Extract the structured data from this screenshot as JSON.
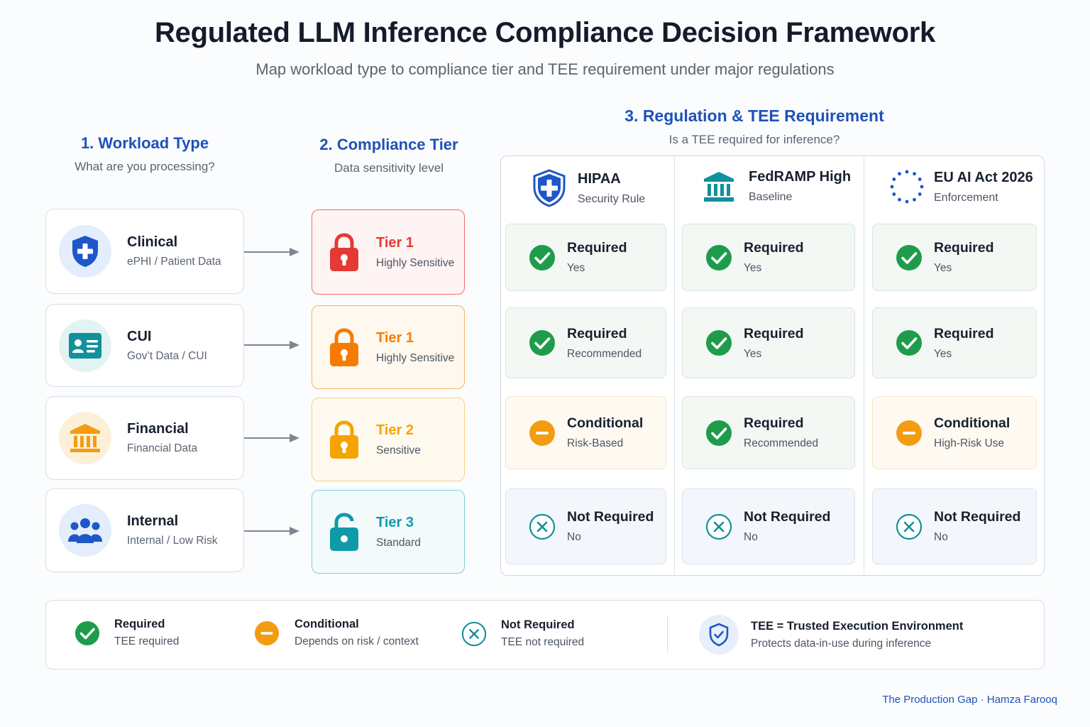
{
  "title": "Regulated LLM Inference Compliance Decision Framework",
  "subtitle": "Map workload type to compliance tier and TEE requirement under major regulations",
  "columns": [
    {
      "heading": "1. Workload Type",
      "sub": "What are you processing?"
    },
    {
      "heading": "2. Compliance Tier",
      "sub": "Data sensitivity level"
    },
    {
      "heading": "3. Regulation & TEE Requirement",
      "sub": "Is a TEE required for inference?"
    }
  ],
  "workloads": [
    {
      "title": "Clinical",
      "sub": "ePHI / Patient Data",
      "icon": "shield-plus-icon"
    },
    {
      "title": "CUI",
      "sub": "Gov’t Data / CUI",
      "icon": "id-card-icon"
    },
    {
      "title": "Financial",
      "sub": "Financial Data",
      "icon": "bank-icon"
    },
    {
      "title": "Internal",
      "sub": "Internal / Low Risk",
      "icon": "people-icon"
    }
  ],
  "tiers": [
    {
      "title": "Tier 1",
      "sub": "Highly Sensitive",
      "color": "#e53935",
      "icon": "lock-closed-icon"
    },
    {
      "title": "Tier 1",
      "sub": "Highly Sensitive",
      "color": "#f57c00",
      "icon": "lock-closed-icon"
    },
    {
      "title": "Tier 2",
      "sub": "Sensitive",
      "color": "#f5a300",
      "icon": "lock-closed-icon"
    },
    {
      "title": "Tier 3",
      "sub": "Standard",
      "color": "#0f9aa8",
      "icon": "lock-open-icon"
    }
  ],
  "regulations": [
    {
      "title": "HIPAA",
      "sub": "Security Rule",
      "icon": "shield-plus-icon"
    },
    {
      "title": "FedRAMP High",
      "sub": "Baseline",
      "icon": "bank-icon"
    },
    {
      "title": "EU AI Act 2026",
      "sub": "Enforcement",
      "icon": "eu-stars-icon"
    }
  ],
  "matrix": [
    [
      {
        "status": "Required",
        "sub": "Yes"
      },
      {
        "status": "Required",
        "sub": "Yes"
      },
      {
        "status": "Required",
        "sub": "Yes"
      }
    ],
    [
      {
        "status": "Required",
        "sub": "Recommended"
      },
      {
        "status": "Required",
        "sub": "Yes"
      },
      {
        "status": "Required",
        "sub": "Yes"
      }
    ],
    [
      {
        "status": "Conditional",
        "sub": "Risk-Based"
      },
      {
        "status": "Required",
        "sub": "Recommended"
      },
      {
        "status": "Conditional",
        "sub": "High-Risk Use"
      }
    ],
    [
      {
        "status": "Not Required",
        "sub": "No"
      },
      {
        "status": "Not Required",
        "sub": "No"
      },
      {
        "status": "Not Required",
        "sub": "No"
      }
    ]
  ],
  "legend": [
    {
      "title": "Required",
      "sub": "TEE required",
      "icon": "check-icon"
    },
    {
      "title": "Conditional",
      "sub": "Depends on risk / context",
      "icon": "minus-icon"
    },
    {
      "title": "Not Required",
      "sub": "TEE not required",
      "icon": "x-icon"
    },
    {
      "title": "TEE = Trusted Execution Environment",
      "sub": "Protects data-in-use during inference",
      "icon": "shield-check-icon"
    }
  ],
  "credit": "The Production Gap · Hamza Farooq",
  "colors": {
    "accent": "#1f52b8",
    "required": "#1e9c4b",
    "conditional": "#f39c12",
    "not_required": "#12909c"
  }
}
